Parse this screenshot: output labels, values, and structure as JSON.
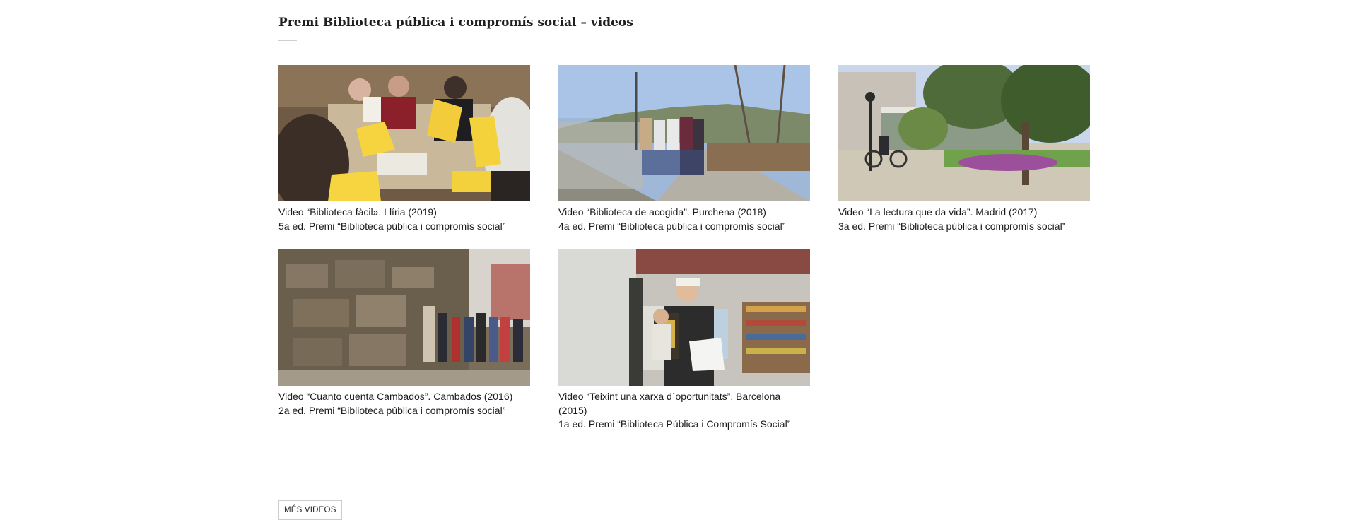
{
  "section": {
    "title": "Premi Biblioteca pública i compromís social – videos"
  },
  "videos": [
    {
      "title": "Video “Biblioteca fàcil». Llíria (2019)",
      "edition": "5a ed. Premi “Biblioteca pública i compromís social”",
      "thumbnail": "reading-group-yellow-sheets-image"
    },
    {
      "title": "Video “Biblioteca de acogida”. Purchena (2018)",
      "edition": "4a ed. Premi “Biblioteca pública i compromís social”",
      "thumbnail": "women-walking-path-image"
    },
    {
      "title": "Video “La lectura que da vida”. Madrid (2017)",
      "edition": "3a ed. Premi “Biblioteca pública i compromís social”",
      "thumbnail": "library-building-garden-image"
    },
    {
      "title": "Video “Cuanto cuenta Cambados”. Cambados (2016)",
      "edition": "2a ed. Premi “Biblioteca pública i compromís social”",
      "thumbnail": "group-by-stone-wall-image"
    },
    {
      "title": "Video “Teixint una xarxa d´oportunitats”. Barcelona (2015)",
      "edition": "1a ed. Premi “Biblioteca Pública i Compromís Social”",
      "thumbnail": "youth-reading-in-library-image"
    }
  ],
  "more_button": {
    "label": "MÉS VIDEOS"
  }
}
